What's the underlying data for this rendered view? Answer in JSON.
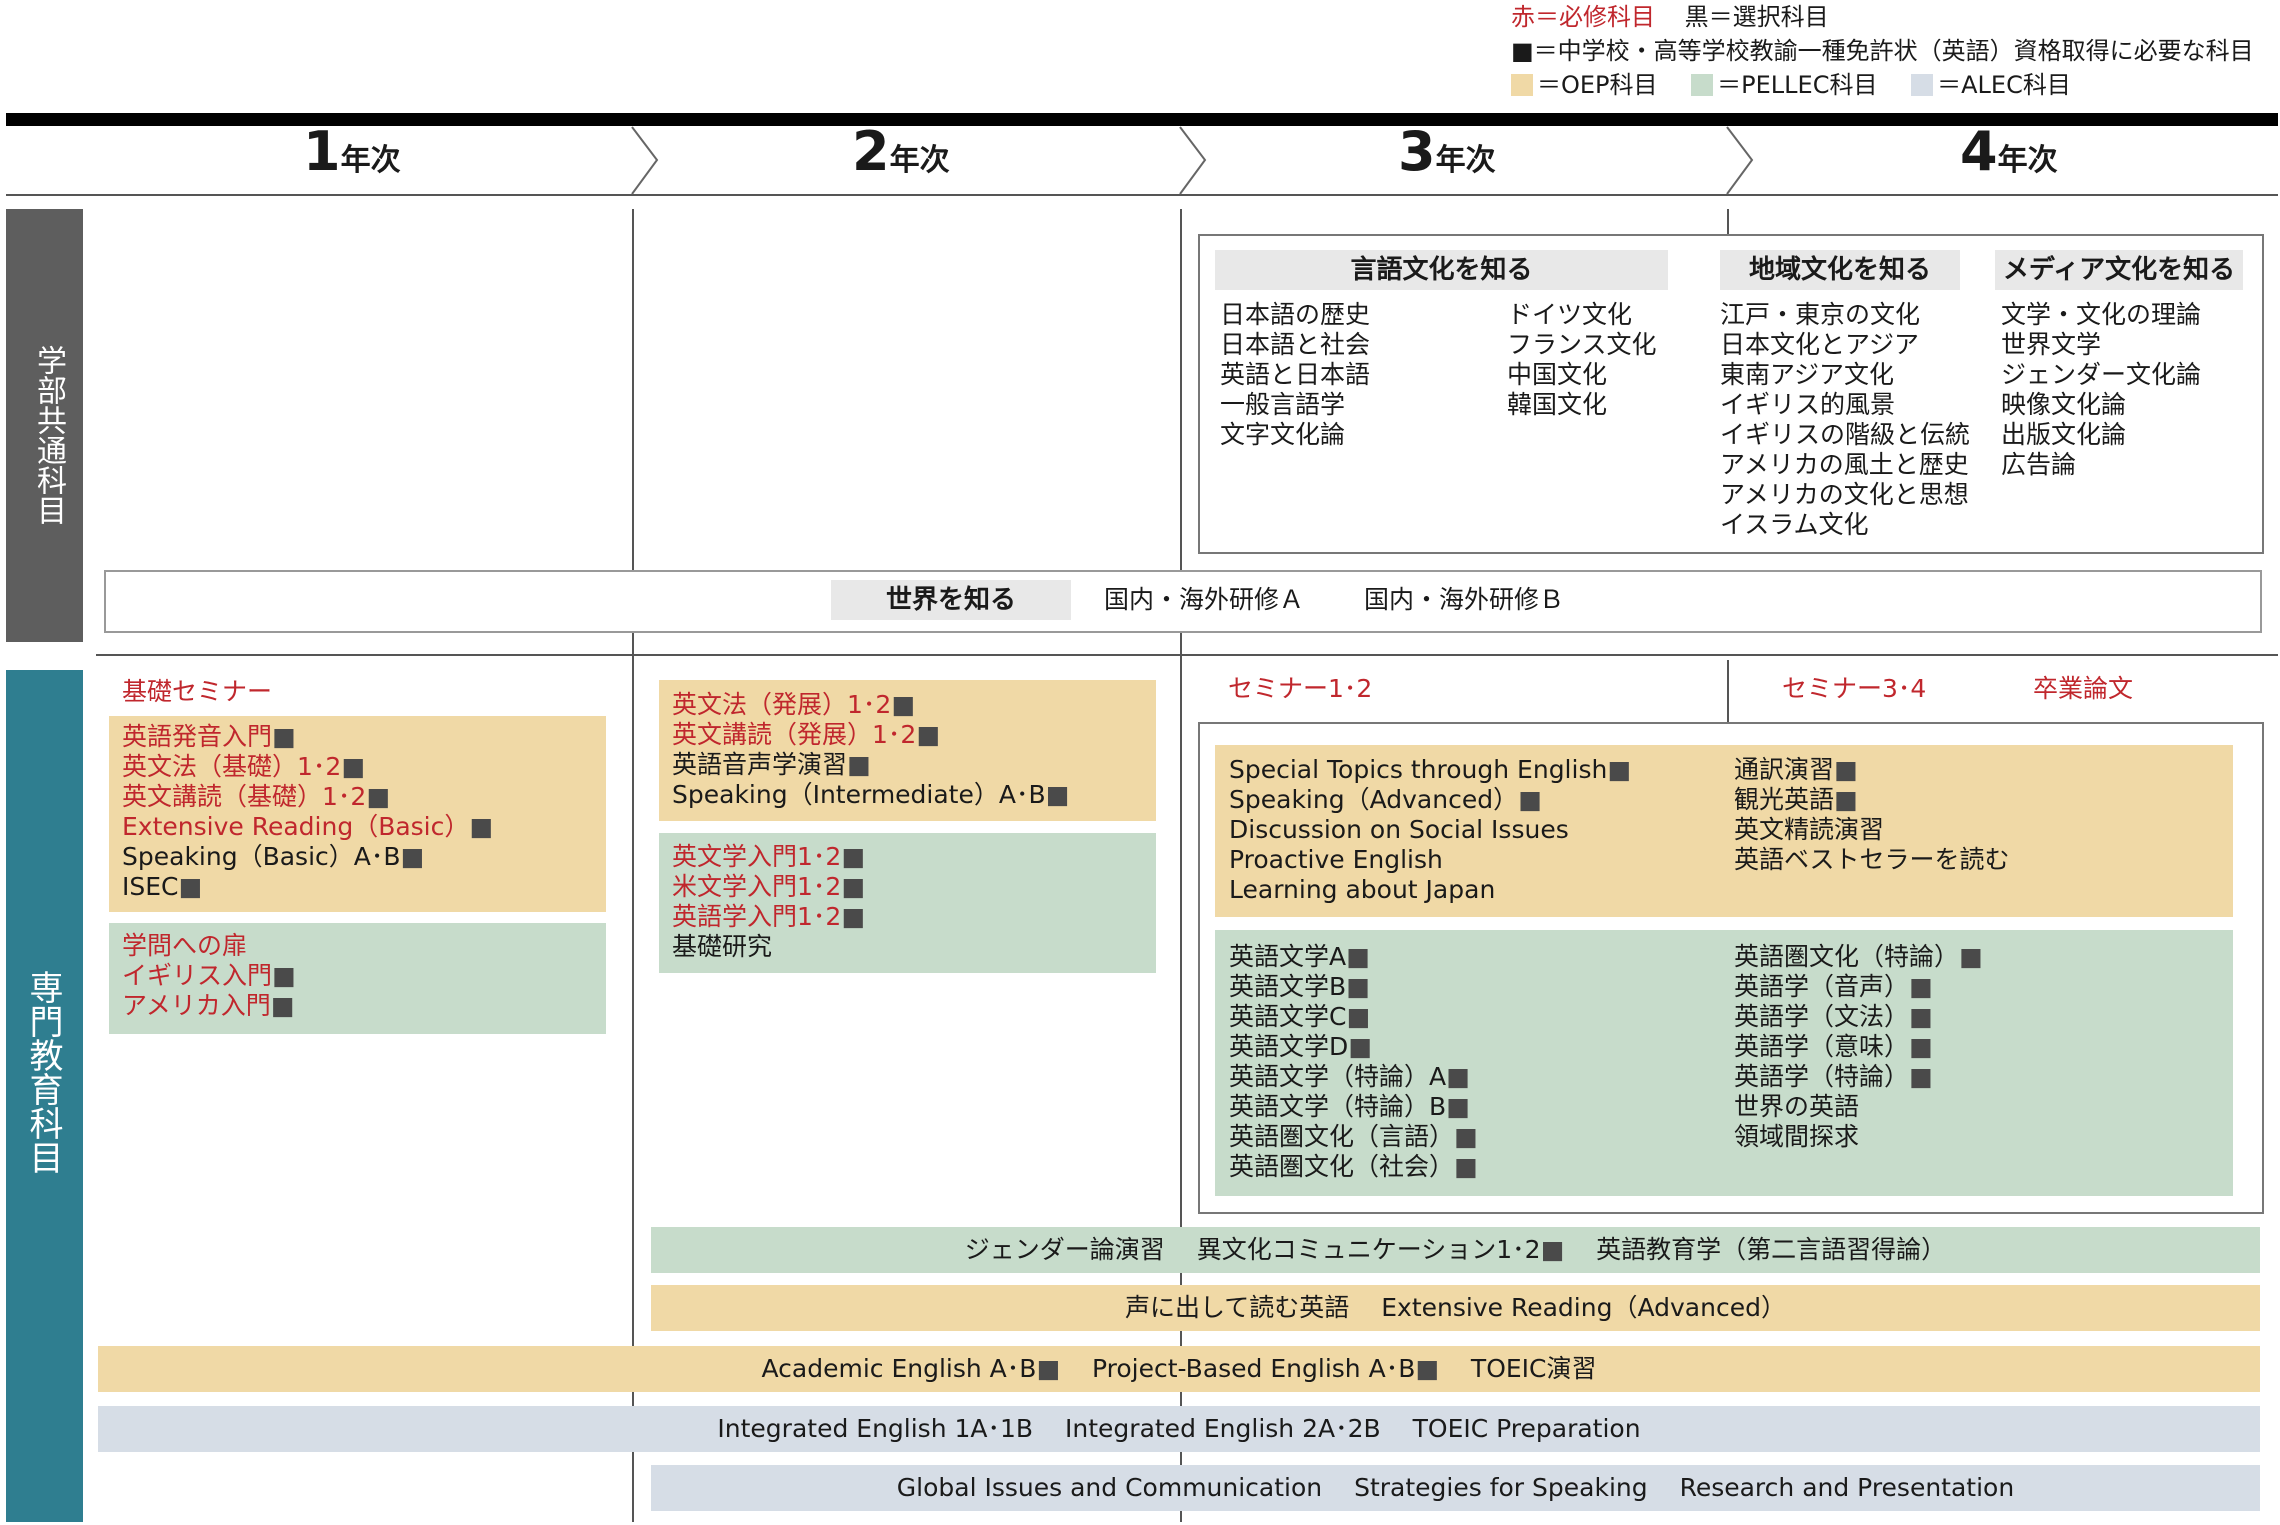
{
  "legend": {
    "required": "赤＝必修科目",
    "elective": "黒＝選択科目",
    "license": "■＝中学校・高等学校教諭一種免許状（英語）資格取得に必要な科目",
    "oep": "＝OEP科目",
    "pellec": "＝PELLEC科目",
    "alec": "＝ALEC科目"
  },
  "colors": {
    "oep": "#f0d9a6",
    "pellec": "#c7dccb",
    "alec": "#d6dde6",
    "required": "#c0272d",
    "side_common": "#5e5e5e",
    "side_major": "#2f7e90"
  },
  "years": [
    {
      "num": "1",
      "label": "年次"
    },
    {
      "num": "2",
      "label": "年次"
    },
    {
      "num": "3",
      "label": "年次"
    },
    {
      "num": "4",
      "label": "年次"
    }
  ],
  "sections": {
    "common": "学部共通科目",
    "major": "専門教育科目"
  },
  "common": {
    "language": {
      "heading": "言語文化を知る",
      "col1": [
        "日本語の歴史",
        "日本語と社会",
        "英語と日本語",
        "一般言語学",
        "文字文化論"
      ],
      "col2": [
        "ドイツ文化",
        "フランス文化",
        "中国文化",
        "韓国文化"
      ]
    },
    "region": {
      "heading": "地域文化を知る",
      "items": [
        "江戸・東京の文化",
        "日本文化とアジア",
        "東南アジア文化",
        "イギリス的風景",
        "イギリスの階級と伝統",
        "アメリカの風土と歴史",
        "アメリカの文化と思想",
        "イスラム文化"
      ]
    },
    "media": {
      "heading": "メディア文化を知る",
      "items": [
        "文学・文化の理論",
        "世界文学",
        "ジェンダー文化論",
        "映像文化論",
        "出版文化論",
        "広告論"
      ]
    },
    "world": {
      "heading": "世界を知る",
      "items": [
        "国内・海外研修Ａ",
        "国内・海外研修Ｂ"
      ]
    }
  },
  "major": {
    "y1_seminar": "基礎セミナー",
    "y1_oep": [
      "英語発音入門",
      "英文法（基礎）1･2",
      "英文講読（基礎）1･2",
      "Extensive Reading（Basic）",
      "Speaking（Basic）A･B",
      "ISEC"
    ],
    "y1_pellec": [
      "学問への扉",
      "イギリス入門",
      "アメリカ入門"
    ],
    "y2_oep": [
      "英文法（発展）1･2",
      "英文講読（発展）1･2",
      "英語音声学演習",
      "Speaking（Intermediate）A･B"
    ],
    "y2_pellec": [
      "英文学入門1･2",
      "米文学入門1･2",
      "英語学入門1･2",
      "基礎研究"
    ],
    "y3_seminar": "セミナー1･2",
    "y4_seminar": "セミナー3･4",
    "y4_thesis": "卒業論文",
    "y34_oep_left": [
      "Special Topics through English",
      "Speaking（Advanced）",
      "Discussion on Social Issues",
      "Proactive English",
      "Learning about Japan"
    ],
    "y34_oep_right": [
      "通訳演習",
      "観光英語",
      "英文精読演習",
      "英語ベストセラーを読む"
    ],
    "y34_pellec_left": [
      "英語文学A",
      "英語文学B",
      "英語文学C",
      "英語文学D",
      "英語文学（特論）A",
      "英語文学（特論）B",
      "英語圏文化（言語）",
      "英語圏文化（社会）"
    ],
    "y34_pellec_right": [
      "英語圏文化（特論）",
      "英語学（音声）",
      "英語学（文法）",
      "英語学（意味）",
      "英語学（特論）",
      "世界の英語",
      "領域間探求"
    ],
    "bar1": [
      "ジェンダー論演習",
      "異文化コミュニケーション1･2",
      "英語教育学（第二言語習得論）"
    ],
    "bar2": [
      "声に出して読む英語",
      "Extensive Reading（Advanced）"
    ],
    "bar3": [
      "Academic English A･B",
      "Project-Based English A･B",
      "TOEIC演習"
    ],
    "bar4": [
      "Integrated English 1A･1B",
      "Integrated English 2A･2B",
      "TOEIC Preparation"
    ],
    "bar5": [
      "Global Issues and Communication",
      "Strategies for Speaking",
      "Research and Presentation"
    ]
  }
}
